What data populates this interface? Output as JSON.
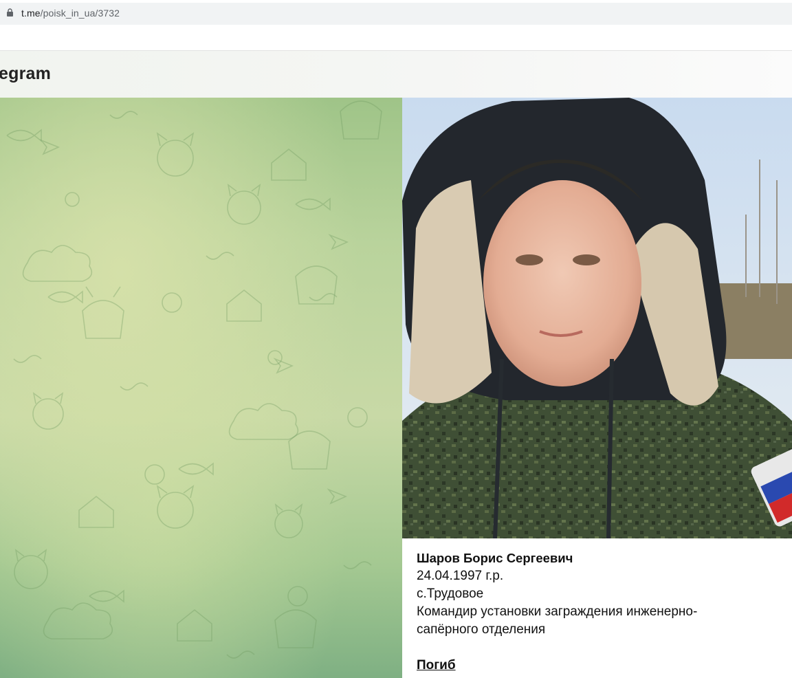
{
  "browser": {
    "url_domain": "t.me",
    "url_path": "/poisk_in_ua/3732"
  },
  "header": {
    "logo_text": "egram"
  },
  "message": {
    "name": "Шаров Борис Сергеевич",
    "birth": "24.04.1997 г.р.",
    "village": "с.Трудовое",
    "role_line1": "Командир установки заграждения инженерно-",
    "role_line2": "сапёрного отделения",
    "status_link": "Погиб"
  },
  "colors": {
    "pattern_stroke": "#6f9b62",
    "header_bg": "#f3f5f1"
  },
  "icons": [
    "lock-icon"
  ]
}
